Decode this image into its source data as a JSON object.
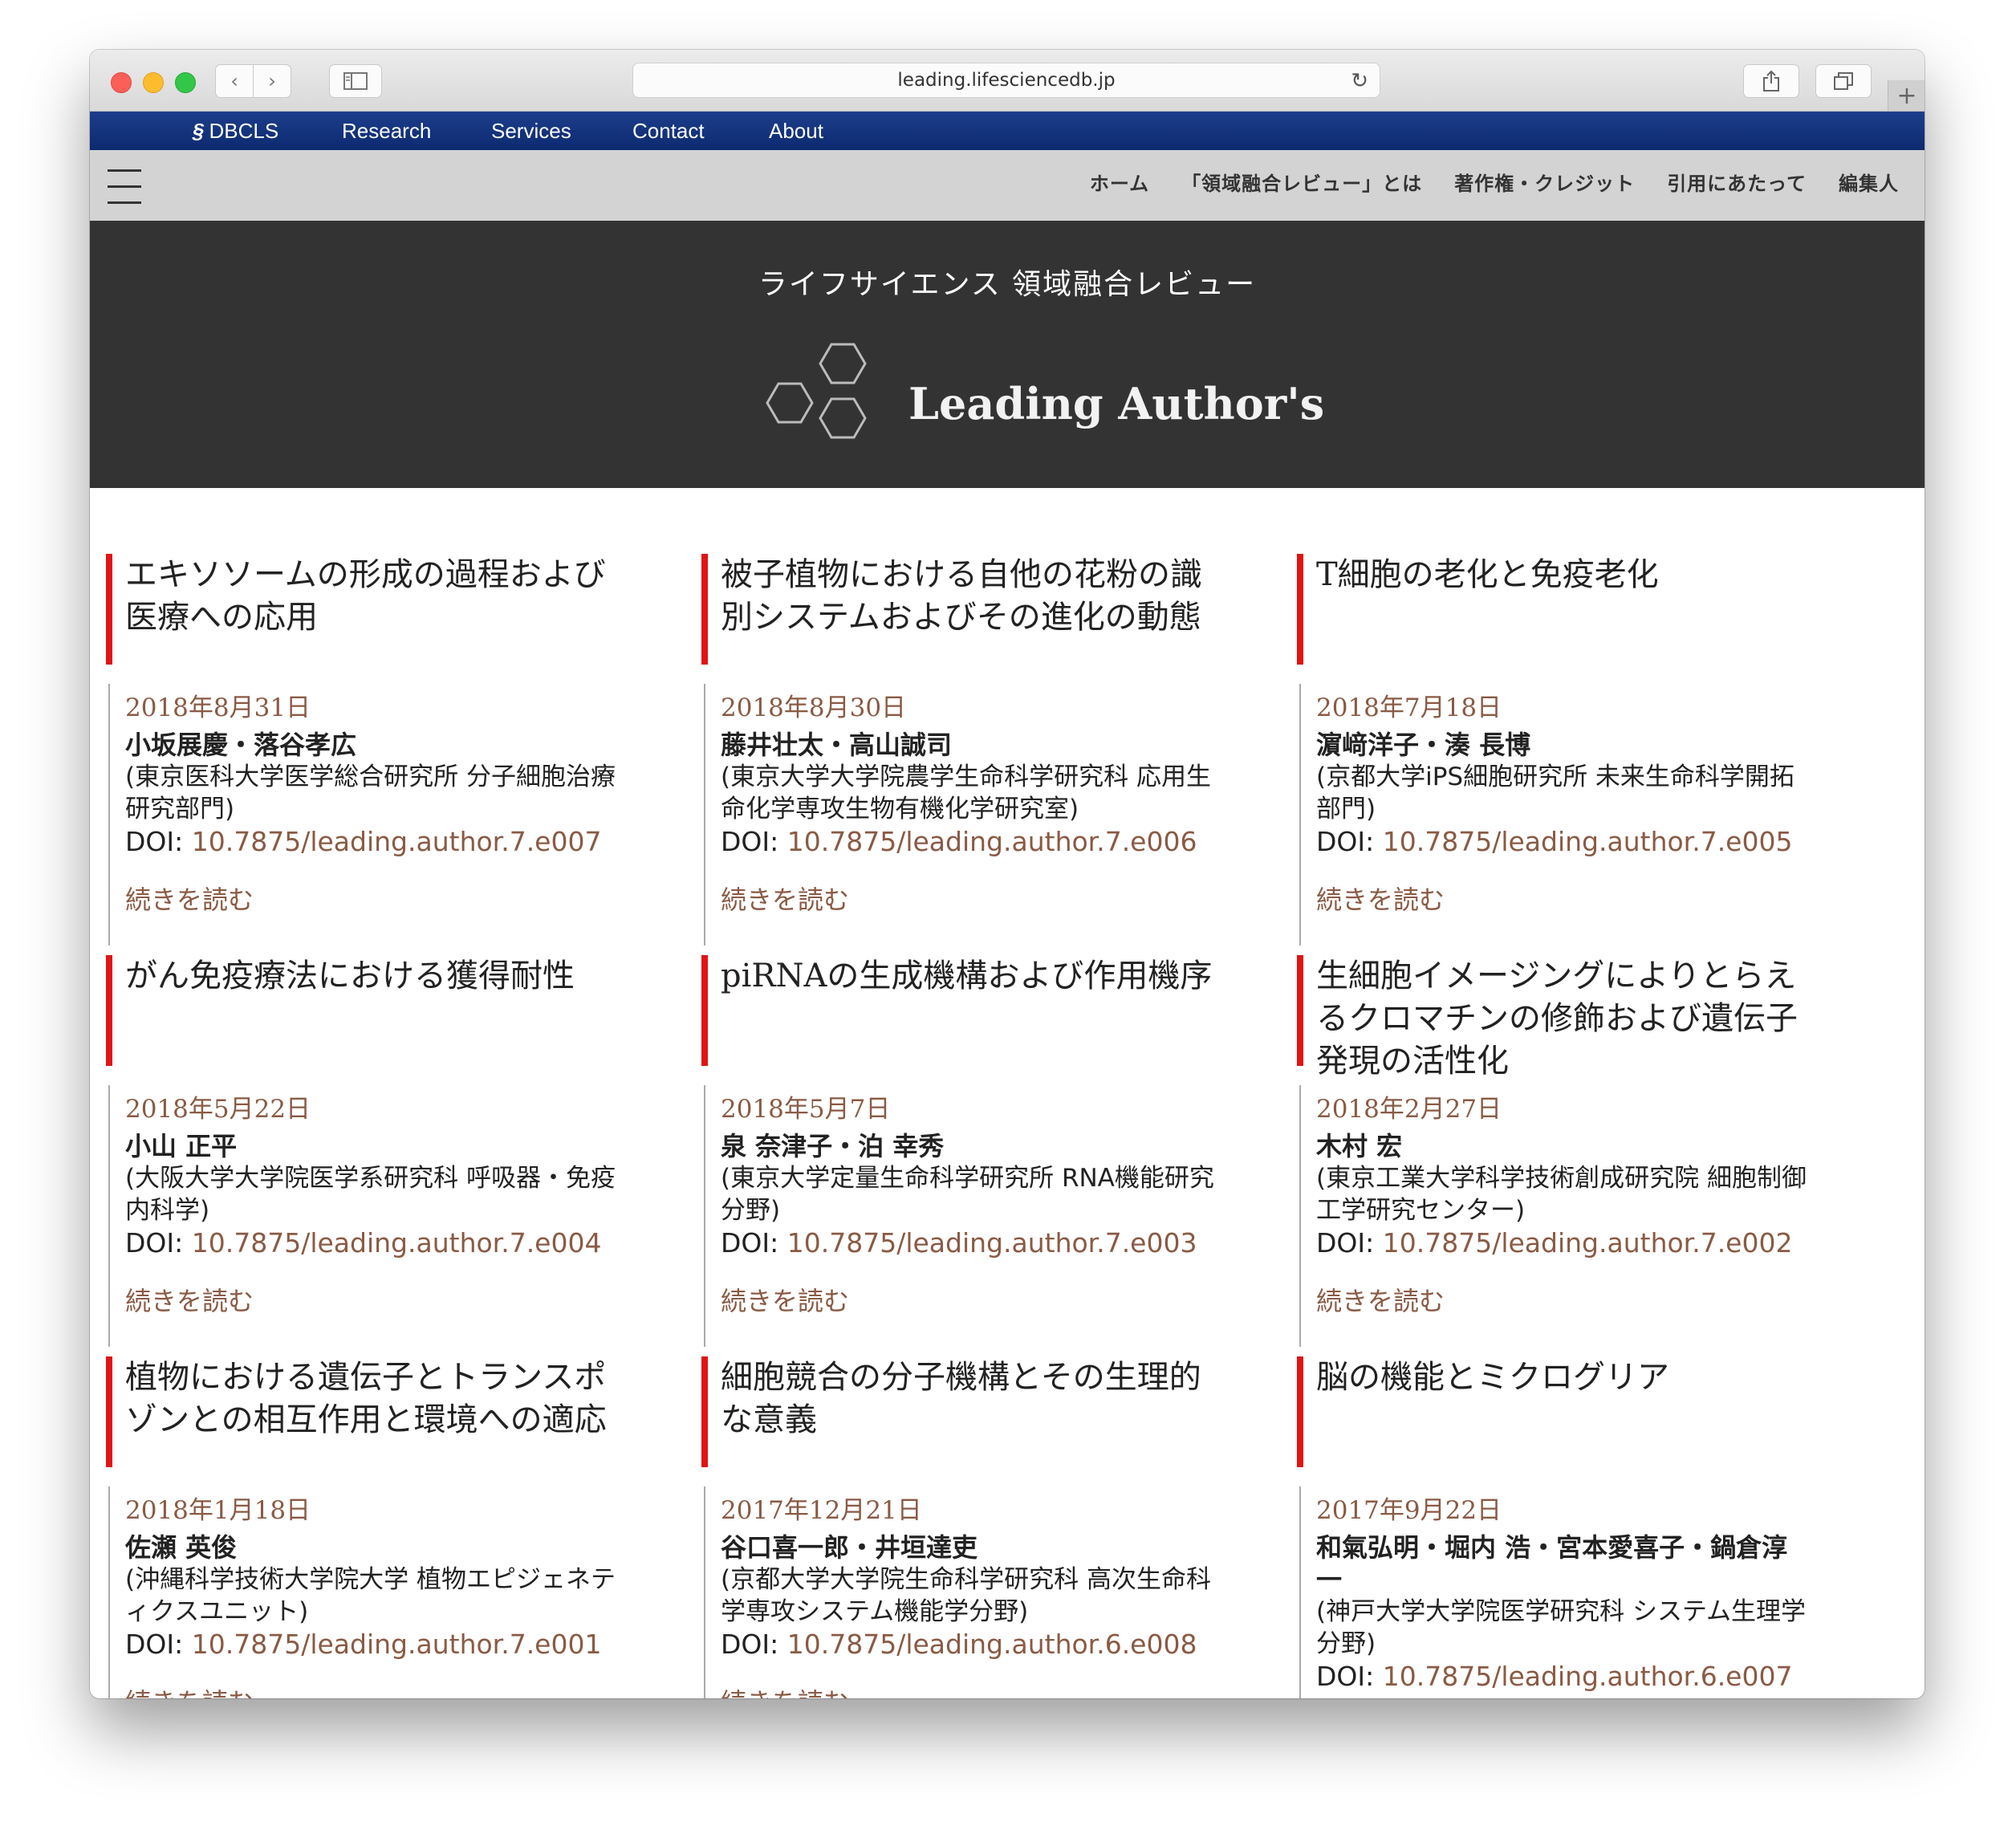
{
  "browser": {
    "url": "leading.lifesciencedb.jp"
  },
  "top_bar": {
    "brand": "DBCLS",
    "links": [
      "Research",
      "Services",
      "Contact",
      "About"
    ]
  },
  "sub_nav": {
    "links": [
      "ホーム",
      "「領域融合レビュー」とは",
      "著作権・クレジット",
      "引用にあたって",
      "編集人"
    ]
  },
  "hero": {
    "subtitle": "ライフサイエンス 領域融合レビュー",
    "title": "Leading Author's"
  },
  "read_more_label": "続きを読む",
  "doi_prefix": "DOI:",
  "articles": [
    {
      "title": "エキソソームの形成の過程および医療への応用",
      "date": "2018年8月31日",
      "authors": "小坂展慶・落谷孝広",
      "affiliation": "(東京医科大学医学総合研究所 分子細胞治療研究部門)",
      "doi": "10.7875/leading.author.7.e007"
    },
    {
      "title": "被子植物における自他の花粉の識別システムおよびその進化の動態",
      "date": "2018年8月30日",
      "authors": "藤井壮太・高山誠司",
      "affiliation": "(東京大学大学院農学生命科学研究科 応用生命化学専攻生物有機化学研究室)",
      "doi": "10.7875/leading.author.7.e006"
    },
    {
      "title": "T細胞の老化と免疫老化",
      "date": "2018年7月18日",
      "authors": "濵﨑洋子・湊 長博",
      "affiliation": "(京都大学iPS細胞研究所 未来生命科学開拓部門)",
      "doi": "10.7875/leading.author.7.e005"
    },
    {
      "title": "がん免疫療法における獲得耐性",
      "date": "2018年5月22日",
      "authors": "小山 正平",
      "affiliation": "(大阪大学大学院医学系研究科 呼吸器・免疫内科学)",
      "doi": "10.7875/leading.author.7.e004"
    },
    {
      "title": "piRNAの生成機構および作用機序",
      "date": "2018年5月7日",
      "authors": "泉 奈津子・泊 幸秀",
      "affiliation": "(東京大学定量生命科学研究所 RNA機能研究分野)",
      "doi": "10.7875/leading.author.7.e003"
    },
    {
      "title": "生細胞イメージングによりとらえるクロマチンの修飾および遺伝子発現の活性化",
      "date": "2018年2月27日",
      "authors": "木村 宏",
      "affiliation": "(東京工業大学科学技術創成研究院 細胞制御工学研究センター)",
      "doi": "10.7875/leading.author.7.e002"
    },
    {
      "title": "植物における遺伝子とトランスポゾンとの相互作用と環境への適応",
      "date": "2018年1月18日",
      "authors": "佐瀬 英俊",
      "affiliation": "(沖縄科学技術大学院大学 植物エピジェネティクスユニット)",
      "doi": "10.7875/leading.author.7.e001"
    },
    {
      "title": "細胞競合の分子機構とその生理的な意義",
      "date": "2017年12月21日",
      "authors": "谷口喜一郎・井垣達吏",
      "affiliation": "(京都大学大学院生命科学研究科 高次生命科学専攻システム機能学分野)",
      "doi": "10.7875/leading.author.6.e008"
    },
    {
      "title": "脳の機能とミクログリア",
      "date": "2017年9月22日",
      "authors": "和氣弘明・堀内 浩・宮本愛喜子・鍋倉淳一",
      "affiliation": "(神戸大学大学院医学研究科 システム生理学分野)",
      "doi": "10.7875/leading.author.6.e007"
    }
  ]
}
